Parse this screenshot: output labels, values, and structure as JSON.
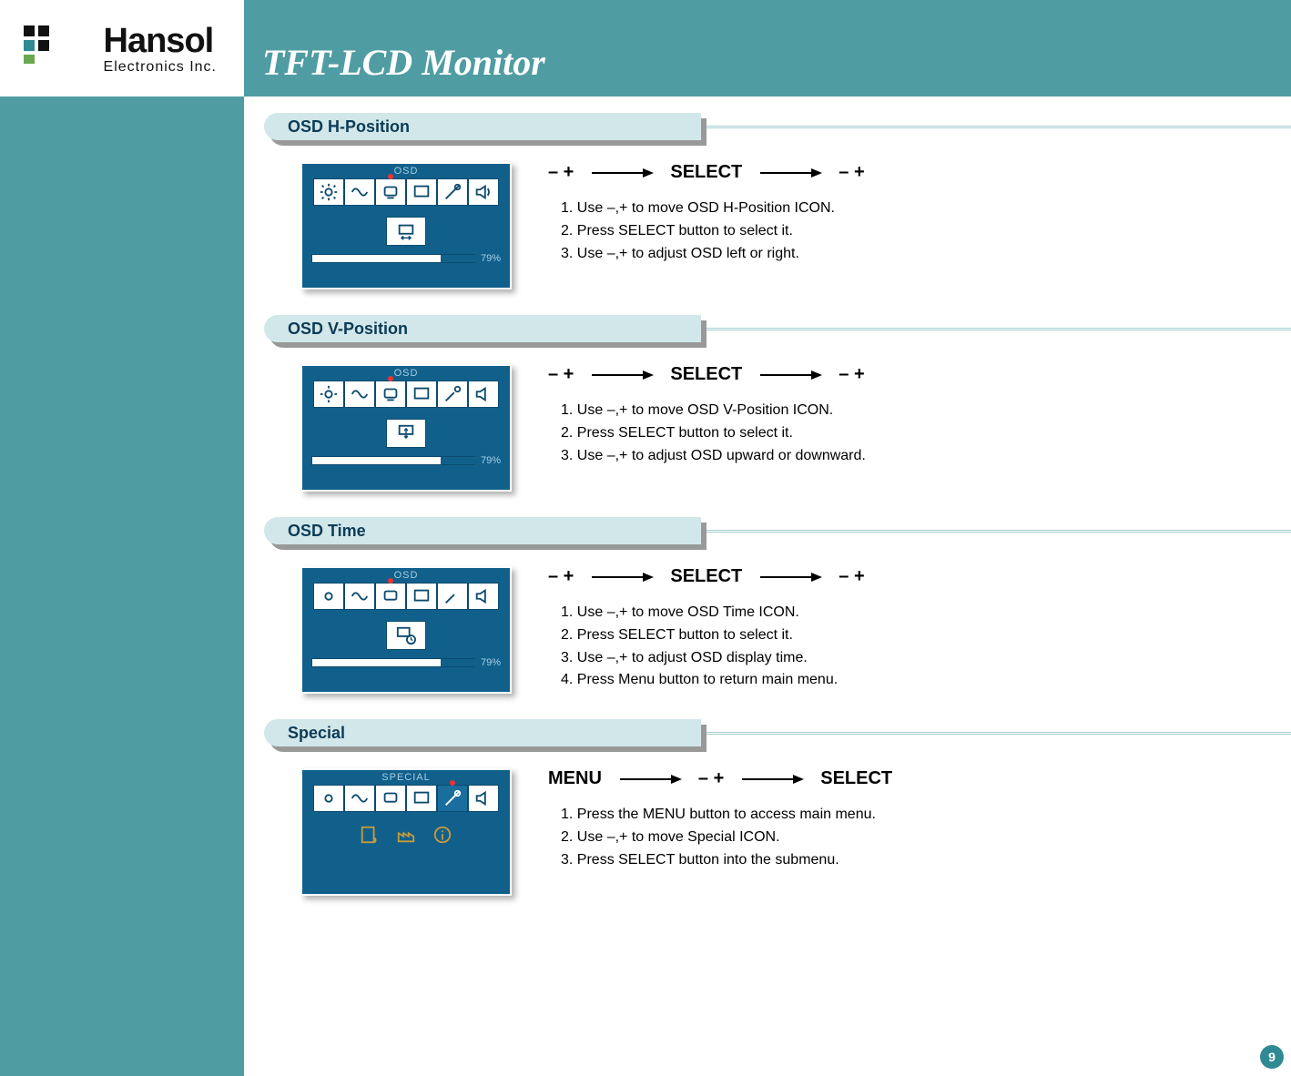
{
  "brand": {
    "name": "Hansol",
    "sub": "Electronics Inc."
  },
  "title": "TFT-LCD Monitor",
  "page_number": "9",
  "osd_label": "OSD",
  "special_label": "SPECIAL",
  "progress_pct": "79%",
  "flow_tokens": {
    "minus_plus": "–  +",
    "select": "SELECT",
    "menu": "MENU"
  },
  "sections": [
    {
      "id": "hpos",
      "title": "OSD H-Position",
      "panel": {
        "type": "osd",
        "center": "hpos",
        "progress": true
      },
      "flow": [
        "minus_plus",
        "arrow",
        "select",
        "arrow",
        "minus_plus"
      ],
      "steps": [
        "1. Use –,+ to move OSD H-Position ICON.",
        "2. Press SELECT button to select it.",
        "3. Use –,+ to adjust OSD left or right."
      ]
    },
    {
      "id": "vpos",
      "title": "OSD V-Position",
      "panel": {
        "type": "osd",
        "center": "vpos",
        "progress": true
      },
      "flow": [
        "minus_plus",
        "arrow",
        "select",
        "arrow",
        "minus_plus"
      ],
      "steps": [
        "1. Use –,+ to move OSD V-Position ICON.",
        "2. Press SELECT button to select it.",
        "3. Use –,+ to adjust OSD upward or downward."
      ]
    },
    {
      "id": "time",
      "title": "OSD Time",
      "panel": {
        "type": "osd",
        "center": "time",
        "progress": true
      },
      "flow": [
        "minus_plus",
        "arrow",
        "select",
        "arrow",
        "minus_plus"
      ],
      "steps": [
        "1. Use –,+ to move OSD Time ICON.",
        "2. Press SELECT button to select it.",
        "3. Use –,+ to adjust OSD display time.",
        "4. Press Menu button to return main menu."
      ]
    },
    {
      "id": "special",
      "title": "Special",
      "panel": {
        "type": "special"
      },
      "flow": [
        "menu",
        "arrow",
        "minus_plus",
        "arrow",
        "select"
      ],
      "steps": [
        "1. Press the MENU button to access main menu.",
        "2. Use –,+ to move Special ICON.",
        "3. Press SELECT button into the submenu."
      ]
    }
  ]
}
